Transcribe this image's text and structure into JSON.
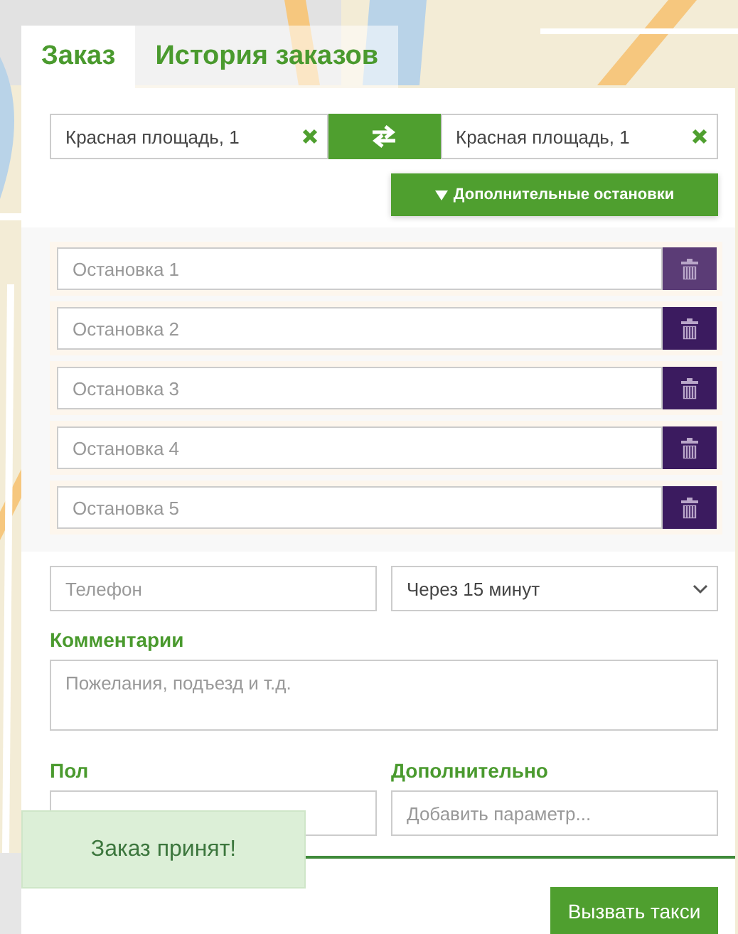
{
  "tabs": [
    {
      "label": "Заказ",
      "selected": true
    },
    {
      "label": "История заказов",
      "selected": false
    }
  ],
  "route": {
    "from": "Красная площадь,  1",
    "to": "Красная площадь,  1"
  },
  "extra_stops_button": "Дополнительные остановки",
  "stops": [
    {
      "placeholder": "Остановка 1",
      "highlighted": true
    },
    {
      "placeholder": "Остановка 2",
      "highlighted": false
    },
    {
      "placeholder": "Остановка 3",
      "highlighted": false
    },
    {
      "placeholder": "Остановка 4",
      "highlighted": false
    },
    {
      "placeholder": "Остановка 5",
      "highlighted": false
    }
  ],
  "phone": {
    "placeholder": "Телефон"
  },
  "time": {
    "value": "Через 15 минут"
  },
  "comments": {
    "label": "Комментарии",
    "placeholder": "Пожелания, подъезд и т.д."
  },
  "gender": {
    "label": "Пол"
  },
  "extra": {
    "label": "Дополнительно",
    "placeholder": "Добавить параметр..."
  },
  "toast": "Заказ принят!",
  "submit": "Вызвать такси"
}
